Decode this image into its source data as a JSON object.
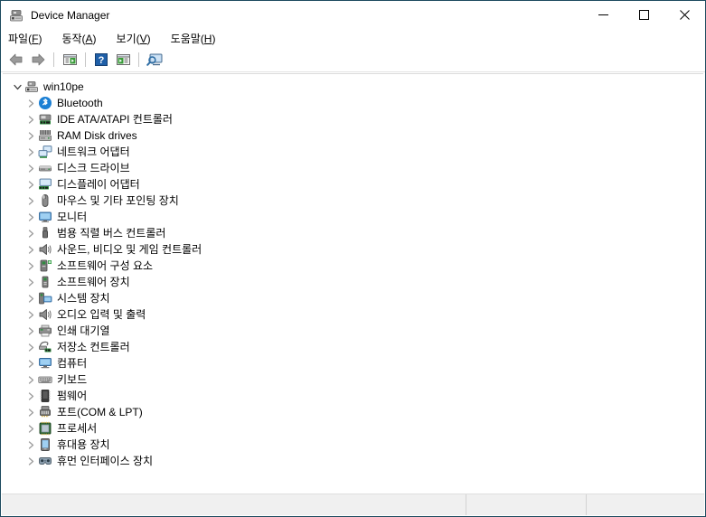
{
  "window": {
    "title": "Device Manager",
    "title_icon": "device-manager-icon",
    "border_color": "#1d4a5e",
    "minimize_label": "—",
    "maximize_label": "□",
    "close_label": "✕"
  },
  "menubar": {
    "items": [
      {
        "name": "file",
        "text": "파일",
        "accel": "F"
      },
      {
        "name": "action",
        "text": "동작",
        "accel": "A"
      },
      {
        "name": "view",
        "text": "보기",
        "accel": "V"
      },
      {
        "name": "help",
        "text": "도움말",
        "accel": "H"
      }
    ]
  },
  "toolbar": {
    "buttons": [
      {
        "name": "back",
        "icon": "back-arrow-icon"
      },
      {
        "name": "forward",
        "icon": "forward-arrow-icon"
      },
      {
        "name": "separator-1",
        "icon": "separator"
      },
      {
        "name": "show-hide-console-tree",
        "icon": "console-tree-icon"
      },
      {
        "name": "separator-2",
        "icon": "separator"
      },
      {
        "name": "help",
        "icon": "help-question-icon"
      },
      {
        "name": "properties",
        "icon": "properties-icon"
      },
      {
        "name": "separator-3",
        "icon": "separator"
      },
      {
        "name": "scan-for-hardware-changes",
        "icon": "scan-hardware-icon"
      }
    ]
  },
  "tree": {
    "root": {
      "label": "win10pe",
      "icon": "computer-device-icon",
      "expanded": true
    },
    "children": [
      {
        "label": "Bluetooth",
        "icon": "bluetooth-icon"
      },
      {
        "label": "IDE ATA/ATAPI 컨트롤러",
        "icon": "ide-controller-icon"
      },
      {
        "label": "RAM Disk drives",
        "icon": "ram-disk-icon"
      },
      {
        "label": "네트워크 어댑터",
        "icon": "network-adapter-icon"
      },
      {
        "label": "디스크 드라이브",
        "icon": "disk-drive-icon"
      },
      {
        "label": "디스플레이 어댑터",
        "icon": "display-adapter-icon"
      },
      {
        "label": "마우스 및 기타 포인팅 장치",
        "icon": "mouse-icon"
      },
      {
        "label": "모니터",
        "icon": "monitor-icon"
      },
      {
        "label": "범용 직렬 버스 컨트롤러",
        "icon": "usb-controller-icon"
      },
      {
        "label": "사운드, 비디오 및 게임 컨트롤러",
        "icon": "speaker-icon"
      },
      {
        "label": "소프트웨어 구성 요소",
        "icon": "software-component-icon"
      },
      {
        "label": "소프트웨어 장치",
        "icon": "software-device-icon"
      },
      {
        "label": "시스템 장치",
        "icon": "system-device-icon"
      },
      {
        "label": "오디오 입력 및 출력",
        "icon": "audio-io-icon"
      },
      {
        "label": "인쇄 대기열",
        "icon": "print-queue-icon"
      },
      {
        "label": "저장소 컨트롤러",
        "icon": "storage-controller-icon"
      },
      {
        "label": "컴퓨터",
        "icon": "computer-icon"
      },
      {
        "label": "키보드",
        "icon": "keyboard-icon"
      },
      {
        "label": "펌웨어",
        "icon": "firmware-icon"
      },
      {
        "label": "포트(COM & LPT)",
        "icon": "ports-icon"
      },
      {
        "label": "프로세서",
        "icon": "processor-icon"
      },
      {
        "label": "휴대용 장치",
        "icon": "portable-device-icon"
      },
      {
        "label": "휴먼 인터페이스 장치",
        "icon": "hid-icon"
      }
    ]
  },
  "statusbar": {
    "pane1": "",
    "pane2": "",
    "pane3": ""
  }
}
